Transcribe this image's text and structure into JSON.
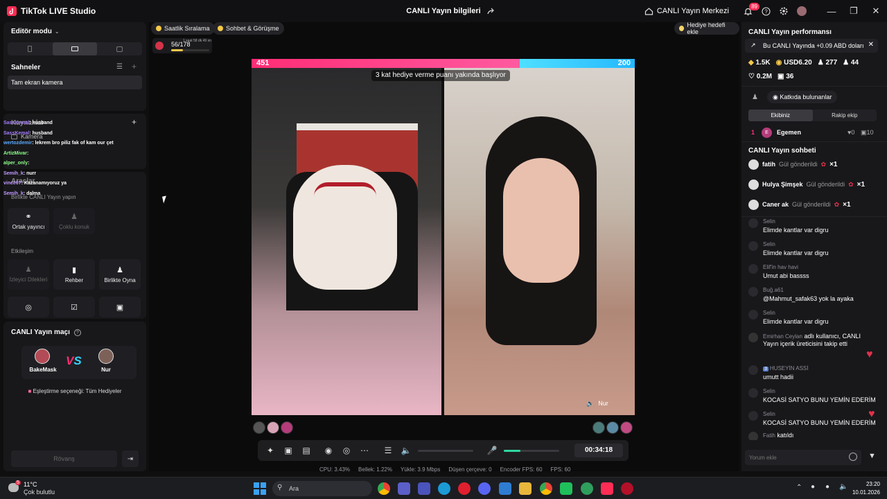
{
  "titlebar": {
    "app_title": "TikTok LIVE Studio",
    "center_title": "CANLI Yayın bilgileri",
    "hub_label": "CANLI Yayın Merkezi",
    "notif_count": "89"
  },
  "left": {
    "editor_mode": "Editör modu",
    "scenes_title": "Sahneler",
    "scene_item": "Tam ekran kamera",
    "sources_title": "Kaynaklar",
    "source_item": "Kamera",
    "tools_title": "Araçlar",
    "collab_title": "Birlikte CANLI Yayın yapın",
    "tool_cohost": "Ortak yayıncı",
    "tool_multiguest": "Çoklu konuk",
    "interaction_title": "Etkileşim",
    "tool_requests": "İzleyici Dilekleri",
    "tool_guide": "Rehber",
    "tool_playtogether": "Birlikte Oyna",
    "match_title": "CANLI Yayın maçı",
    "player1": "BakeMask",
    "player2": "Nur",
    "matching_option": "Eşleştirme seçeneği: Tüm Hediyeler",
    "rematch": "Rövanş"
  },
  "overlay_chat": [
    {
      "user": "SassKemal",
      "text": ": husband"
    },
    {
      "user": "SassKemal",
      "text": ": husband"
    },
    {
      "user": "wertozdemir",
      "text": ": lekrem bro piliz fak of kam our çet"
    },
    {
      "user": "ArtizMivar",
      "text": ":"
    },
    {
      "user": "alper_only",
      "text": ":"
    },
    {
      "user": "Semih_k",
      "text": ": nurr"
    },
    {
      "user": "vince07",
      "text": ": Kazanamıyoruz ya"
    },
    {
      "user": "Semih_k",
      "text": ": dalma"
    }
  ],
  "stage": {
    "pill_ranking": "Saatlik Sıralama",
    "pill_chat": "Sohbet & Görüşme",
    "pill_gift_goal": "Hediye hedefi ekle",
    "progress_text": "56/178",
    "progress_fraction": 0.31,
    "progress_sub": "1 saat 58 dk 49 sn",
    "score_left": "451",
    "score_right": "200",
    "score_left_share": 0.7,
    "banner": "3 kat hediye verme puanı yakında başlıyor",
    "guest_tag": "Nur",
    "timer": "00:34:18",
    "mic_level": 0.3
  },
  "stats": {
    "cpu": "CPU: 3.43%",
    "memory": "Bellek: 1.22%",
    "upload": "Yükle: 3.9 Mbps",
    "dropped": "Düşen çerçeve: 0",
    "encoder": "Encoder FPS: 60",
    "fps": "FPS: 60"
  },
  "right": {
    "performance_title": "CANLI Yayın performansı",
    "notice": "Bu CANLI Yayında +0.09 ABD doları",
    "metric_diamonds": "1.5K",
    "metric_usd": "USD6.20",
    "metric_viewers": "277",
    "metric_follows": "44",
    "metric_likes": "0.2M",
    "metric_gifts": "36",
    "contributors_btn": "Katkıda bulunanlar",
    "tab_team": "Ekibiniz",
    "tab_rival": "Rakip ekip",
    "contrib_rank": "1",
    "contrib_name": "Egemen",
    "contrib_likes": "0",
    "contrib_score": "10",
    "chat_title": "CANLI Yayın sohbeti",
    "gifts": [
      {
        "user": "fatih",
        "action": "Gül gönderildi",
        "count": "×1"
      },
      {
        "user": "Hulya Şimşek",
        "action": "Gül gönderildi",
        "count": "×1"
      },
      {
        "user": "Caner ak",
        "action": "Gül gönderildi",
        "count": "×1"
      }
    ],
    "messages": [
      {
        "user": "Selin",
        "text": "Elimde kantlar var digru"
      },
      {
        "user": "Selin",
        "text": "Elimde kantlar var digru"
      },
      {
        "user": "Elif'in hav havi",
        "text": "Umut abi bassss"
      },
      {
        "user": "Buğ.a61",
        "text": "@Mahmut_safak63 yok la ayaka"
      },
      {
        "user": "Selin",
        "text": "Elimde kantlar var digru"
      },
      {
        "user": "Emirhan Ceylan",
        "text": "adlı kullanıcı, CANLI Yayın içerik üreticisini takip etti"
      },
      {
        "user": "HUSEYİN ASSİ",
        "text": "umutt hadii",
        "level": "3"
      },
      {
        "user": "Selin",
        "text": "KOCASİ SATYO BUNU YEMİN EDERİM"
      },
      {
        "user": "Selin",
        "text": "KOCASİ SATYO BUNU YEMİN EDERİM"
      },
      {
        "user": "Fatih",
        "text": "katıldı"
      }
    ],
    "comment_placeholder": "Yorum ekle"
  },
  "taskbar": {
    "weather_temp": "11°C",
    "weather_desc": "Çok bulutlu",
    "weather_badge": "5",
    "search_placeholder": "Ara",
    "time": "23:20",
    "date": "10.01.2026"
  },
  "colors": {
    "accent": "#ff2d75",
    "rival": "#24b8ff",
    "panel": "#18181b",
    "background": "#0f0f10"
  }
}
